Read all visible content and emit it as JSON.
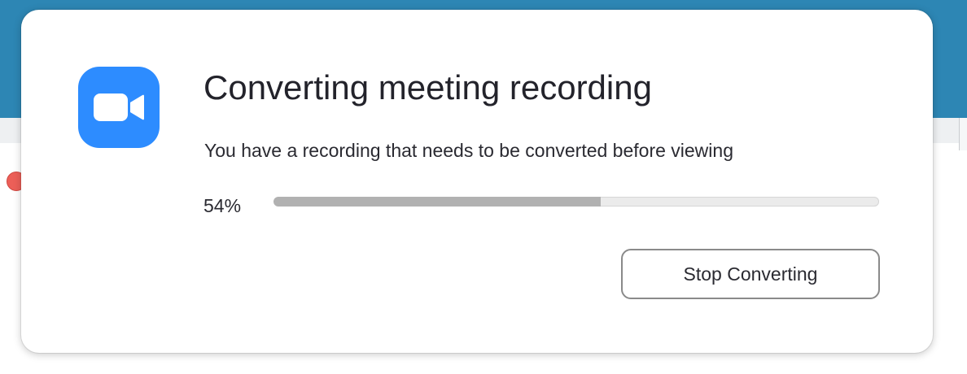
{
  "dialog": {
    "icon": "zoom-video-camera-icon",
    "title": "Converting meeting recording",
    "message": "You have a recording that needs to be converted before viewing",
    "progress": {
      "percent_label": "54%",
      "fraction": 0.54
    },
    "stop_button_label": "Stop Converting"
  },
  "colors": {
    "background_bar": "#2d86b4",
    "app_icon": "#2d8cff",
    "progress_fill": "#b1b1b1",
    "progress_track": "#ebebeb",
    "close_light": "#ec5f58"
  }
}
